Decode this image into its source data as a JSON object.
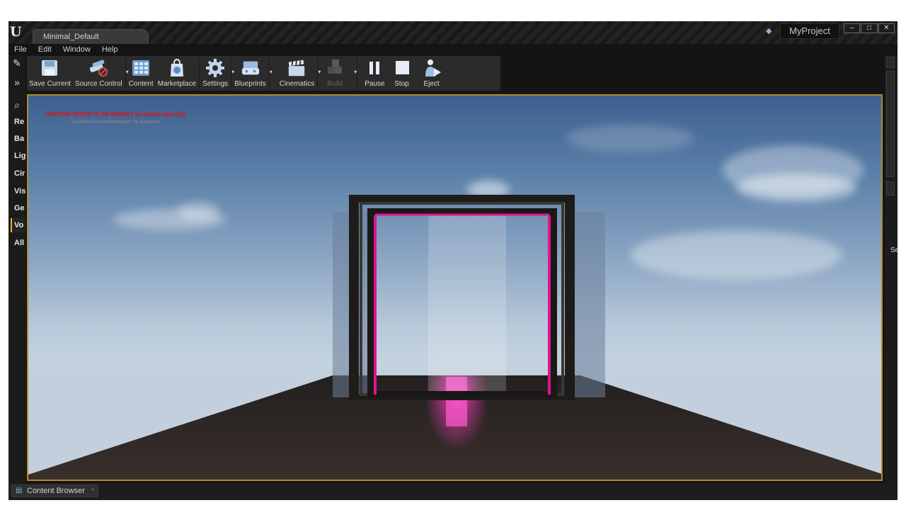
{
  "window": {
    "tab_title": "Minimal_Default",
    "project_name": "MyProject",
    "controls": [
      "–",
      "□",
      "✕"
    ]
  },
  "menu": [
    "File",
    "Edit",
    "Window",
    "Help"
  ],
  "toolbar": {
    "buttons": [
      {
        "label": "Save Current",
        "icon": "save-icon"
      },
      {
        "label": "Source Control",
        "icon": "source-control-icon"
      },
      {
        "label": "Content",
        "icon": "content-icon"
      },
      {
        "label": "Marketplace",
        "icon": "marketplace-icon"
      },
      {
        "label": "Settings",
        "icon": "gear-icon"
      },
      {
        "label": "Blueprints",
        "icon": "blueprints-icon"
      },
      {
        "label": "Cinematics",
        "icon": "clapperboard-icon"
      },
      {
        "label": "Build",
        "icon": "build-icon",
        "disabled": true
      },
      {
        "label": "Pause",
        "icon": "pause-icon"
      },
      {
        "label": "Stop",
        "icon": "stop-icon"
      },
      {
        "label": "Eject",
        "icon": "eject-icon"
      }
    ]
  },
  "modes_panel": {
    "items": [
      "Re",
      "Ba",
      "Lig",
      "Cir",
      "Vis",
      "Ge",
      "Vo",
      "All"
    ],
    "active": "Vo"
  },
  "viewport": {
    "warning": "LIGHTING NEEDS TO BE REBUILT (4 unbuilt object(s))",
    "hint": "'DisableAllScreenMessages' to suppress"
  },
  "details_panel": {
    "label": "Se"
  },
  "bottom": {
    "content_browser_tab": "Content Browser"
  },
  "colors": {
    "accent": "#b38a2f",
    "warning": "#e01010",
    "portal_glow": "#ff1fa8"
  }
}
